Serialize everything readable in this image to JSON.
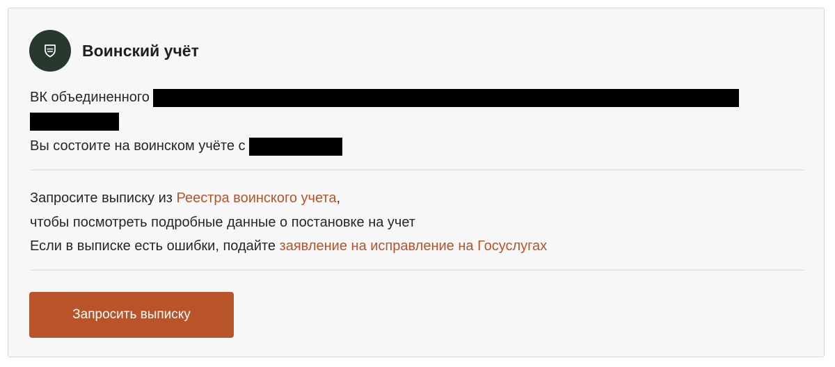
{
  "card": {
    "title": "Воинский учёт",
    "icon": "shield-icon",
    "colors": {
      "icon_bg": "#28382f",
      "accent": "#b8532a"
    }
  },
  "registration": {
    "commissariat_prefix": "ВК объединенного",
    "status_prefix": "Вы состоите на воинском учёте с"
  },
  "extract_info": {
    "line1_prefix": "Запросите выписку из ",
    "line1_link": "Реестра воинского учета",
    "line1_suffix": ",",
    "line2": "чтобы посмотреть подробные данные о постановке на учет",
    "line3_prefix": "Если в выписке есть ошибки, подайте ",
    "line3_link": "заявление на исправление на Госуслугах"
  },
  "actions": {
    "request_button_label": "Запросить выписку"
  }
}
